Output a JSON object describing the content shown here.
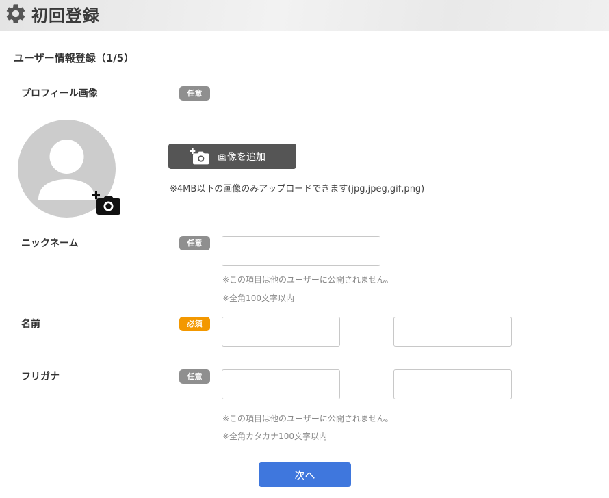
{
  "header": {
    "title": "初回登録",
    "icon": "gear-icon"
  },
  "form": {
    "section_title": "ユーザー情報登録（1/5）",
    "profile_image": {
      "label": "プロフィール画像",
      "badge": "任意",
      "add_button_label": "画像を追加",
      "upload_note": "※4MB以下の画像のみアップロードできます(jpg,jpeg,gif,png)"
    },
    "nickname": {
      "label": "ニックネーム",
      "badge": "任意",
      "value": "",
      "notes": [
        "※この項目は他のユーザーに公開されません。",
        "※全角100文字以内"
      ]
    },
    "name": {
      "label": "名前",
      "badge": "必須",
      "last_value": "",
      "first_value": ""
    },
    "furigana": {
      "label": "フリガナ",
      "badge": "任意",
      "last_value": "",
      "first_value": "",
      "notes": [
        "※この項目は他のユーザーに公開されません。",
        "※全角カタカナ100文字以内"
      ]
    },
    "next_button_label": "次へ"
  },
  "colors": {
    "badge_optional": "#8f8f8f",
    "badge_required": "#f39800",
    "primary_button": "#3f77dd",
    "add_image_button": "#555555"
  }
}
